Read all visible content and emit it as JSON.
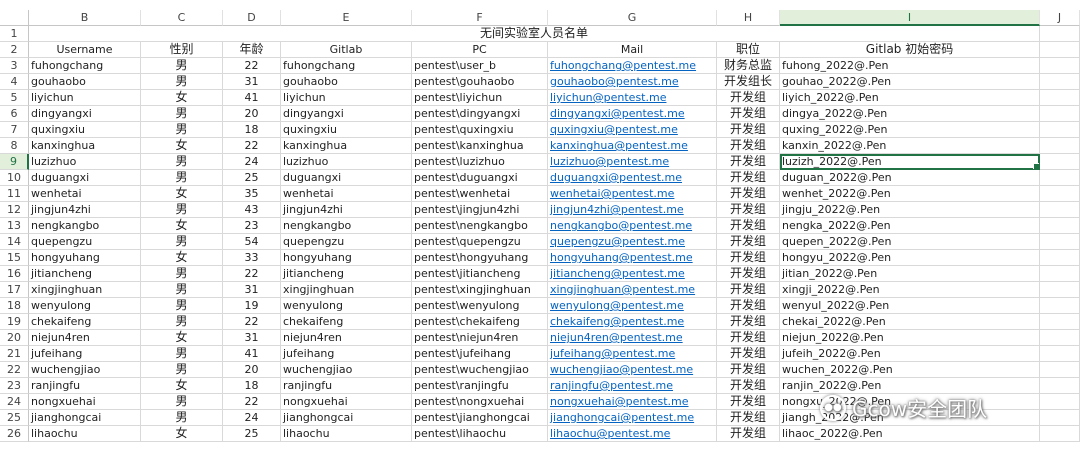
{
  "columns": [
    "B",
    "C",
    "D",
    "E",
    "F",
    "G",
    "H",
    "I",
    "J"
  ],
  "selected_column": "I",
  "selected_row": 9,
  "title": "无间实验室人员名单",
  "headers": [
    "Username",
    "性别",
    "年龄",
    "Gitlab",
    "PC",
    "Mail",
    "职位",
    "Gitlab 初始密码"
  ],
  "rows": [
    {
      "row": "3",
      "username": "fuhongchang",
      "gender": "男",
      "age": "22",
      "gitlab": "fuhongchang",
      "pc": "pentest\\user_b",
      "mail": "fuhongchang@pentest.me",
      "position": "财务总监",
      "password": "fuhong_2022@.Pen"
    },
    {
      "row": "4",
      "username": "gouhaobo",
      "gender": "男",
      "age": "31",
      "gitlab": "gouhaobo",
      "pc": "pentest\\gouhaobo",
      "mail": "gouhaobo@pentest.me",
      "position": "开发组长",
      "password": "gouhao_2022@.Pen"
    },
    {
      "row": "5",
      "username": "liyichun",
      "gender": "女",
      "age": "41",
      "gitlab": "liyichun",
      "pc": "pentest\\liyichun",
      "mail": "liyichun@pentest.me",
      "position": "开发组",
      "password": "liyich_2022@.Pen"
    },
    {
      "row": "6",
      "username": "dingyangxi",
      "gender": "男",
      "age": "20",
      "gitlab": "dingyangxi",
      "pc": "pentest\\dingyangxi",
      "mail": "dingyangxi@pentest.me",
      "position": "开发组",
      "password": "dingya_2022@.Pen"
    },
    {
      "row": "7",
      "username": "quxingxiu",
      "gender": "男",
      "age": "18",
      "gitlab": "quxingxiu",
      "pc": "pentest\\quxingxiu",
      "mail": "quxingxiu@pentest.me",
      "position": "开发组",
      "password": "quxing_2022@.Pen"
    },
    {
      "row": "8",
      "username": "kanxinghua",
      "gender": "女",
      "age": "22",
      "gitlab": "kanxinghua",
      "pc": "pentest\\kanxinghua",
      "mail": "kanxinghua@pentest.me",
      "position": "开发组",
      "password": "kanxin_2022@.Pen"
    },
    {
      "row": "9",
      "username": "luzizhuo",
      "gender": "男",
      "age": "24",
      "gitlab": "luzizhuo",
      "pc": "pentest\\luzizhuo",
      "mail": "luzizhuo@pentest.me",
      "position": "开发组",
      "password": "luzizh_2022@.Pen"
    },
    {
      "row": "10",
      "username": "duguangxi",
      "gender": "男",
      "age": "25",
      "gitlab": "duguangxi",
      "pc": "pentest\\duguangxi",
      "mail": "duguangxi@pentest.me",
      "position": "开发组",
      "password": "duguan_2022@.Pen"
    },
    {
      "row": "11",
      "username": "wenhetai",
      "gender": "女",
      "age": "35",
      "gitlab": "wenhetai",
      "pc": "pentest\\wenhetai",
      "mail": "wenhetai@pentest.me",
      "position": "开发组",
      "password": "wenhet_2022@.Pen"
    },
    {
      "row": "12",
      "username": "jingjun4zhi",
      "gender": "男",
      "age": "43",
      "gitlab": "jingjun4zhi",
      "pc": "pentest\\jingjun4zhi",
      "mail": "jingjun4zhi@pentest.me",
      "position": "开发组",
      "password": "jingju_2022@.Pen"
    },
    {
      "row": "13",
      "username": "nengkangbo",
      "gender": "女",
      "age": "23",
      "gitlab": "nengkangbo",
      "pc": "pentest\\nengkangbo",
      "mail": "nengkangbo@pentest.me",
      "position": "开发组",
      "password": "nengka_2022@.Pen"
    },
    {
      "row": "14",
      "username": "quepengzu",
      "gender": "男",
      "age": "54",
      "gitlab": "quepengzu",
      "pc": "pentest\\quepengzu",
      "mail": "quepengzu@pentest.me",
      "position": "开发组",
      "password": "quepen_2022@.Pen"
    },
    {
      "row": "15",
      "username": "hongyuhang",
      "gender": "女",
      "age": "33",
      "gitlab": "hongyuhang",
      "pc": "pentest\\hongyuhang",
      "mail": "hongyuhang@pentest.me",
      "position": "开发组",
      "password": "hongyu_2022@.Pen"
    },
    {
      "row": "16",
      "username": "jitiancheng",
      "gender": "男",
      "age": "22",
      "gitlab": "jitiancheng",
      "pc": "pentest\\jitiancheng",
      "mail": "jitiancheng@pentest.me",
      "position": "开发组",
      "password": "jitian_2022@.Pen"
    },
    {
      "row": "17",
      "username": "xingjinghuan",
      "gender": "男",
      "age": "31",
      "gitlab": "xingjinghuan",
      "pc": "pentest\\xingjinghuan",
      "mail": "xingjinghuan@pentest.me",
      "position": "开发组",
      "password": "xingji_2022@.Pen"
    },
    {
      "row": "18",
      "username": "wenyulong",
      "gender": "男",
      "age": "19",
      "gitlab": "wenyulong",
      "pc": "pentest\\wenyulong",
      "mail": "wenyulong@pentest.me",
      "position": "开发组",
      "password": "wenyul_2022@.Pen"
    },
    {
      "row": "19",
      "username": "chekaifeng",
      "gender": "男",
      "age": "22",
      "gitlab": "chekaifeng",
      "pc": "pentest\\chekaifeng",
      "mail": "chekaifeng@pentest.me",
      "position": "开发组",
      "password": "chekai_2022@.Pen"
    },
    {
      "row": "20",
      "username": "niejun4ren",
      "gender": "女",
      "age": "31",
      "gitlab": "niejun4ren",
      "pc": "pentest\\niejun4ren",
      "mail": "niejun4ren@pentest.me",
      "position": "开发组",
      "password": "niejun_2022@.Pen"
    },
    {
      "row": "21",
      "username": "jufeihang",
      "gender": "男",
      "age": "41",
      "gitlab": "jufeihang",
      "pc": "pentest\\jufeihang",
      "mail": "jufeihang@pentest.me",
      "position": "开发组",
      "password": "jufeih_2022@.Pen"
    },
    {
      "row": "22",
      "username": "wuchengjiao",
      "gender": "男",
      "age": "20",
      "gitlab": "wuchengjiao",
      "pc": "pentest\\wuchengjiao",
      "mail": "wuchengjiao@pentest.me",
      "position": "开发组",
      "password": "wuchen_2022@.Pen"
    },
    {
      "row": "23",
      "username": "ranjingfu",
      "gender": "女",
      "age": "18",
      "gitlab": "ranjingfu",
      "pc": "pentest\\ranjingfu",
      "mail": "ranjingfu@pentest.me",
      "position": "开发组",
      "password": "ranjin_2022@.Pen"
    },
    {
      "row": "24",
      "username": "nongxuehai",
      "gender": "男",
      "age": "22",
      "gitlab": "nongxuehai",
      "pc": "pentest\\nongxuehai",
      "mail": "nongxuehai@pentest.me",
      "position": "开发组",
      "password": "nongxu_2022@.Pen"
    },
    {
      "row": "25",
      "username": "jianghongcai",
      "gender": "男",
      "age": "24",
      "gitlab": "jianghongcai",
      "pc": "pentest\\jianghongcai",
      "mail": "jianghongcai@pentest.me",
      "position": "开发组",
      "password": "jiangh_2022@.Pen"
    },
    {
      "row": "26",
      "username": "lihaochu",
      "gender": "女",
      "age": "25",
      "gitlab": "lihaochu",
      "pc": "pentest\\lihaochu",
      "mail": "lihaochu@pentest.me",
      "position": "开发组",
      "password": "lihaoc_2022@.Pen"
    }
  ],
  "watermark": {
    "text": "Gcow安全团队",
    "icon": "wechat-logo-icon"
  },
  "colors": {
    "selection_green": "#217346",
    "link_blue": "#0563c1",
    "grid": "#d9d9d9"
  }
}
